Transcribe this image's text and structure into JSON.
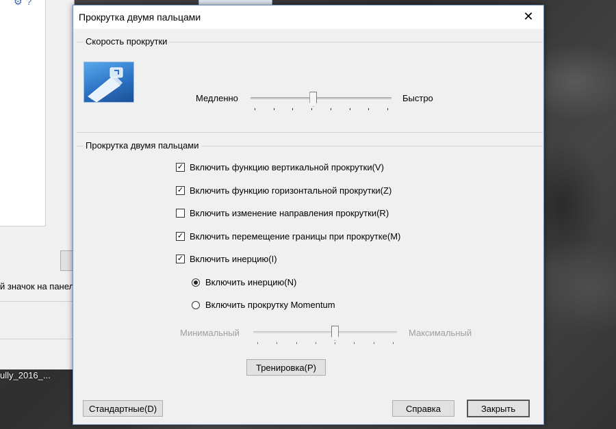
{
  "background": {
    "side_text": "й значок на панел",
    "desktop_label": "ully_2016_..."
  },
  "dialog": {
    "title": "Прокрутка двумя пальцами",
    "close_glyph": "✕",
    "speed_group": {
      "label": "Скорость прокрутки",
      "slow_label": "Медленно",
      "fast_label": "Быстро",
      "level": 0.44,
      "tick_count": 8
    },
    "two_finger_group": {
      "label": "Прокрутка двумя пальцами",
      "options": [
        {
          "label": "Включить функцию вертикальной прокрутки(V)",
          "checked": true
        },
        {
          "label": "Включить функцию горизонтальной прокрутки(Z)",
          "checked": true
        },
        {
          "label": "Включить изменение направления прокрутки(R)",
          "checked": false
        },
        {
          "label": "Включить перемещение границы при прокрутке(M)",
          "checked": true
        },
        {
          "label": "Включить инерцию(I)",
          "checked": true
        }
      ],
      "radios": [
        {
          "label": "Включить инерцию(N)",
          "selected": true
        },
        {
          "label": "Включить прокрутку Momentum",
          "selected": false
        }
      ],
      "momentum_min_label": "Минимальный",
      "momentum_max_label": "Максимальный",
      "momentum_level": 0.57,
      "momentum_tick_count": 8,
      "train_button": "Тренировка(P)"
    },
    "footer": {
      "defaults_button": "Стандартные(D)",
      "help_button": "Справка",
      "close_button": "Закрыть"
    }
  }
}
